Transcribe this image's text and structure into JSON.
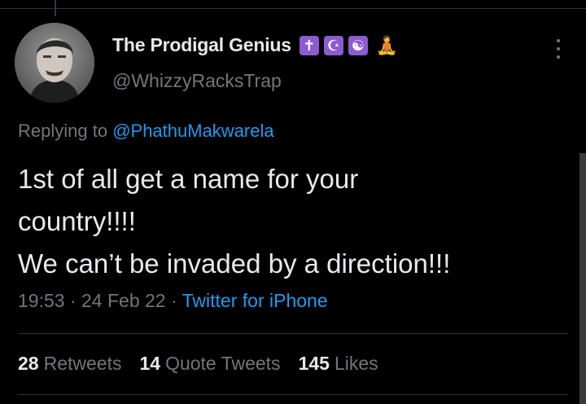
{
  "author": {
    "display_name": "The Prodigal Genius",
    "badges": [
      "✝",
      "☪",
      "☯"
    ],
    "emoji": "🧘",
    "handle": "@WhizzyRacksTrap"
  },
  "reply": {
    "prefix": "Replying to ",
    "mention": "@PhathuMakwarela"
  },
  "tweet": {
    "lines": [
      "1st of all get a name for your",
      "country!!!!",
      "We can’t be invaded by a direction!!!"
    ],
    "time": "19:53",
    "sep1": " · ",
    "date": "24 Feb 22",
    "sep2": " · ",
    "source": "Twitter for iPhone"
  },
  "stats": [
    {
      "count": "28",
      "label": "Retweets"
    },
    {
      "count": "14",
      "label": "Quote Tweets"
    },
    {
      "count": "145",
      "label": "Likes"
    }
  ],
  "icons": {
    "more": "more-vertical-icon"
  }
}
